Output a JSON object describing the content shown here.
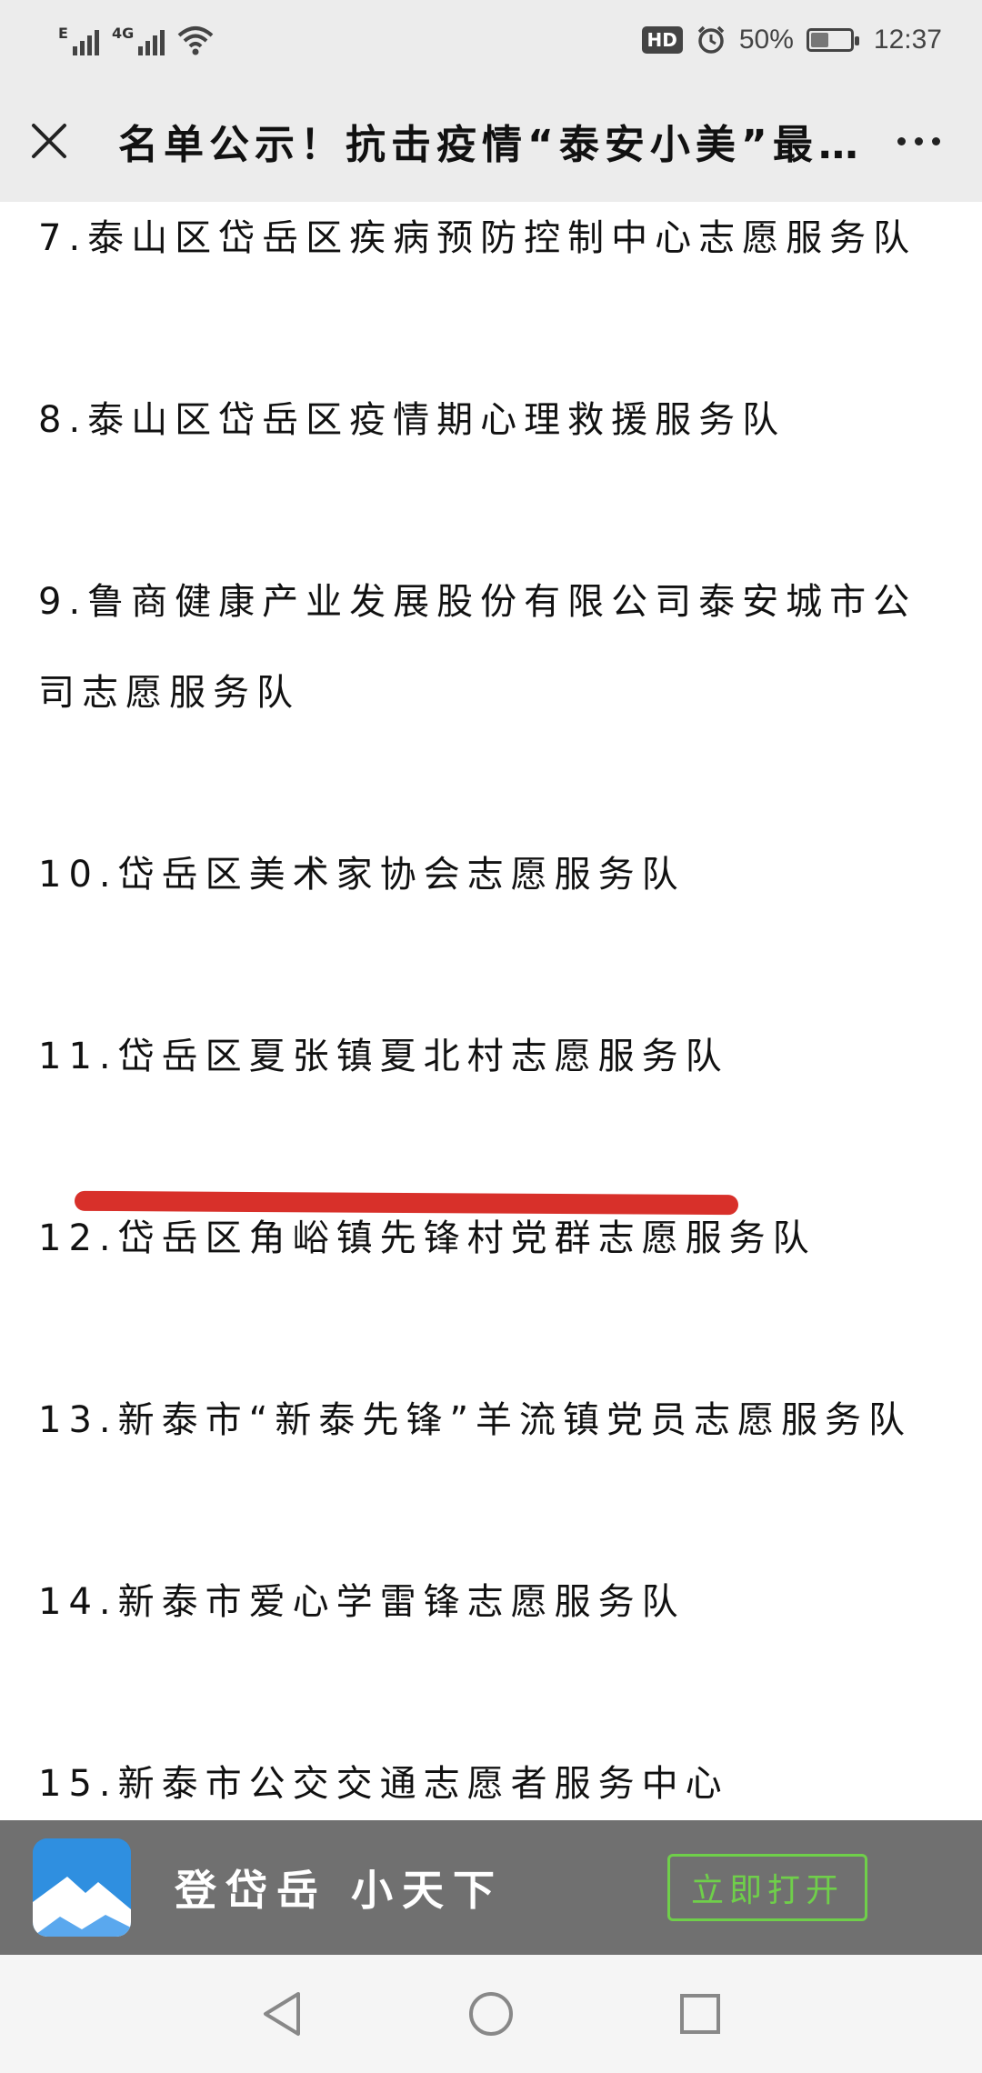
{
  "status_bar": {
    "signal1_label": "E",
    "signal2_label": "4G",
    "hd": "HD",
    "battery": "50%",
    "battery_level": 0.5,
    "time": "12:37"
  },
  "title_bar": {
    "title": "名单公示！抗击疫情“泰安小美”最…"
  },
  "article": {
    "items": [
      "7.泰山区岱岳区疾病预防控制中心志愿服务队",
      "8.泰山区岱岳区疫情期心理救援服务队",
      "9.鲁商健康产业发展股份有限公司泰安城市公司志愿服务队",
      "10.岱岳区美术家协会志愿服务队",
      "11.岱岳区夏张镇夏北村志愿服务队",
      "12.岱岳区角峪镇先锋村党群志愿服务队",
      "13.新泰市“新泰先锋”羊流镇党员志愿服务队",
      "14.新泰市爱心学雷锋志愿服务队",
      "15.新泰市公交交通志愿者服务中心"
    ]
  },
  "banner": {
    "app_name": "登岱岳 小天下",
    "open_label": "立即打开"
  },
  "colors": {
    "accent_green": "#6fcf4a",
    "underline_red": "#d8302a"
  }
}
